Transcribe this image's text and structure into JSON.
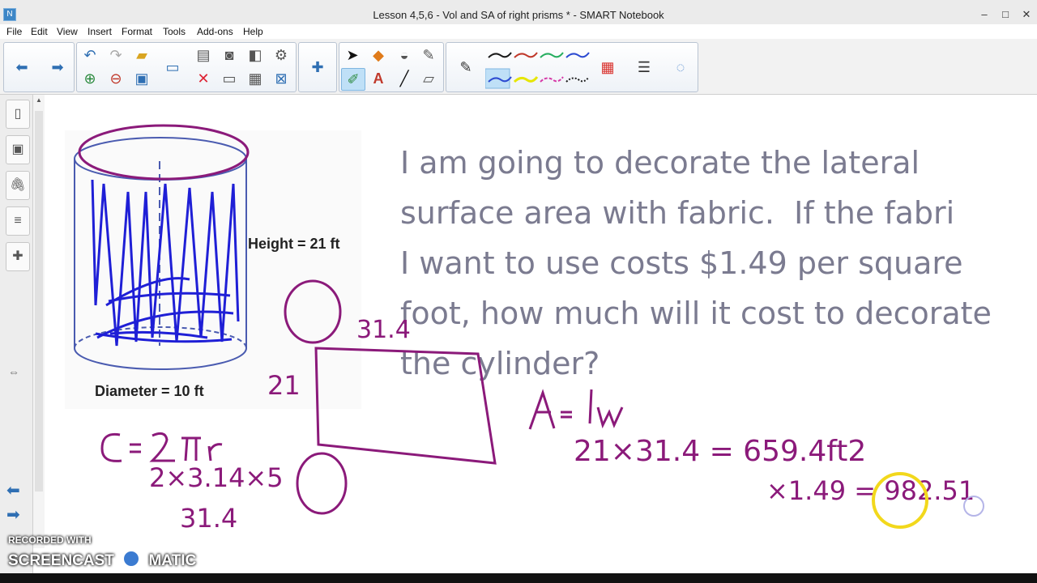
{
  "window": {
    "title": "Lesson 4,5,6 - Vol and SA of right prisms * - SMART Notebook"
  },
  "menu": [
    "File",
    "Edit",
    "View",
    "Insert",
    "Format",
    "Tools",
    "Add-ons",
    "Help"
  ],
  "toolbar": {
    "nav": [
      "arrow-left-icon",
      "arrow-right-icon"
    ],
    "group2": [
      "undo-icon",
      "redo-icon",
      "open-folder-icon",
      "add-page-icon",
      "delete-page-icon",
      "save-icon",
      "screen-shade-icon",
      "camera-icon",
      "paste-icon",
      "table-icon",
      "close-icon",
      "full-screen-icon",
      "properties-icon"
    ],
    "tools": [
      "select-icon",
      "shapes-icon",
      "eraser-icon",
      "fill-icon",
      "pens-icon",
      "text-icon",
      "line-icon",
      "eraser2-icon"
    ],
    "pen_colors": [
      "#1a1a1a",
      "#c0392b",
      "#27ae60",
      "#2d4bd1",
      "#2d4bd1",
      "#e6e600",
      "#d63aa8",
      "#1a1a1a"
    ]
  },
  "problem": {
    "lines": [
      "I am going to decorate the lateral",
      "surface area with fabric.  If the fabri",
      "I want to use costs $1.49 per square",
      "foot, how much will it cost to decorate",
      "the cylinder?"
    ]
  },
  "figure": {
    "height_label": "Height = 21 ft",
    "diameter_label": "Diameter = 10 ft"
  },
  "handwriting": {
    "circumference_formula": "C = 2πr",
    "circumference_sub": "2×3.14×5",
    "circumference_result": "31.4",
    "rect_top": "31.4",
    "rect_side": "21",
    "area_formula": "A = lw",
    "area_calc": "21×31.4 = 659.4ft2",
    "cost_calc": "×1.49 = 982.51"
  },
  "watermark": {
    "recorded_with": "RECORDED WITH",
    "brand_left": "SCREENCAST",
    "brand_right": "MATIC"
  },
  "colors": {
    "ink_purple": "#8b1a7a",
    "ink_blue": "#1f1fd6",
    "text_gray": "#7b7b90",
    "cursor_yellow": "#f2d81c"
  }
}
